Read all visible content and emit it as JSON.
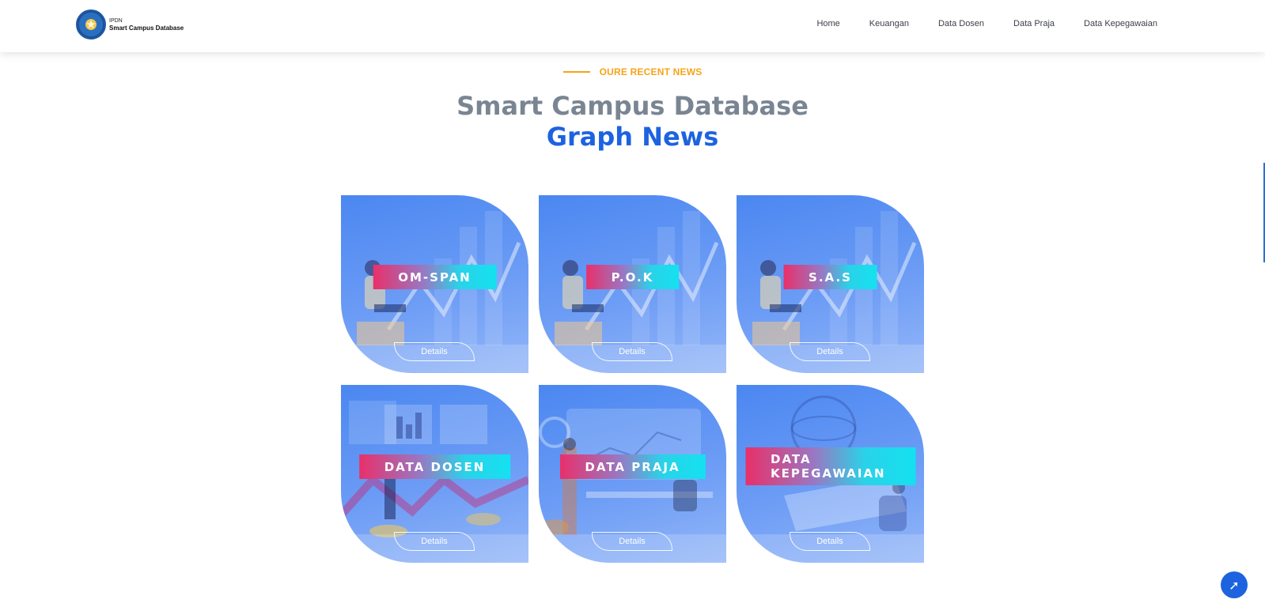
{
  "header": {
    "brand_small": "IPDN",
    "brand_name": "Smart Campus Database",
    "nav": [
      "Home",
      "Keuangan",
      "Data Dosen",
      "Data Praja",
      "Data Kepegawaian"
    ]
  },
  "section": {
    "kicker": "OURE RECENT NEWS",
    "title_line1": "Smart Campus Database",
    "title_line2": "Graph News"
  },
  "cards": [
    {
      "label": "OM-SPAN",
      "button": "Details"
    },
    {
      "label": "P.O.K",
      "button": "Details"
    },
    {
      "label": "S.A.S",
      "button": "Details"
    },
    {
      "label": "DATA DOSEN",
      "button": "Details"
    },
    {
      "label": "DATA PRAJA",
      "button": "Details"
    },
    {
      "label": "DATA KEPEGAWAIAN",
      "button": "Details"
    }
  ],
  "colors": {
    "accent": "#1d63e0",
    "kicker": "#f6a417",
    "title_gray": "#7a8593"
  },
  "icons": {
    "scroll_top": "arrow-up-icon",
    "logo": "ipdn-logo-icon"
  }
}
